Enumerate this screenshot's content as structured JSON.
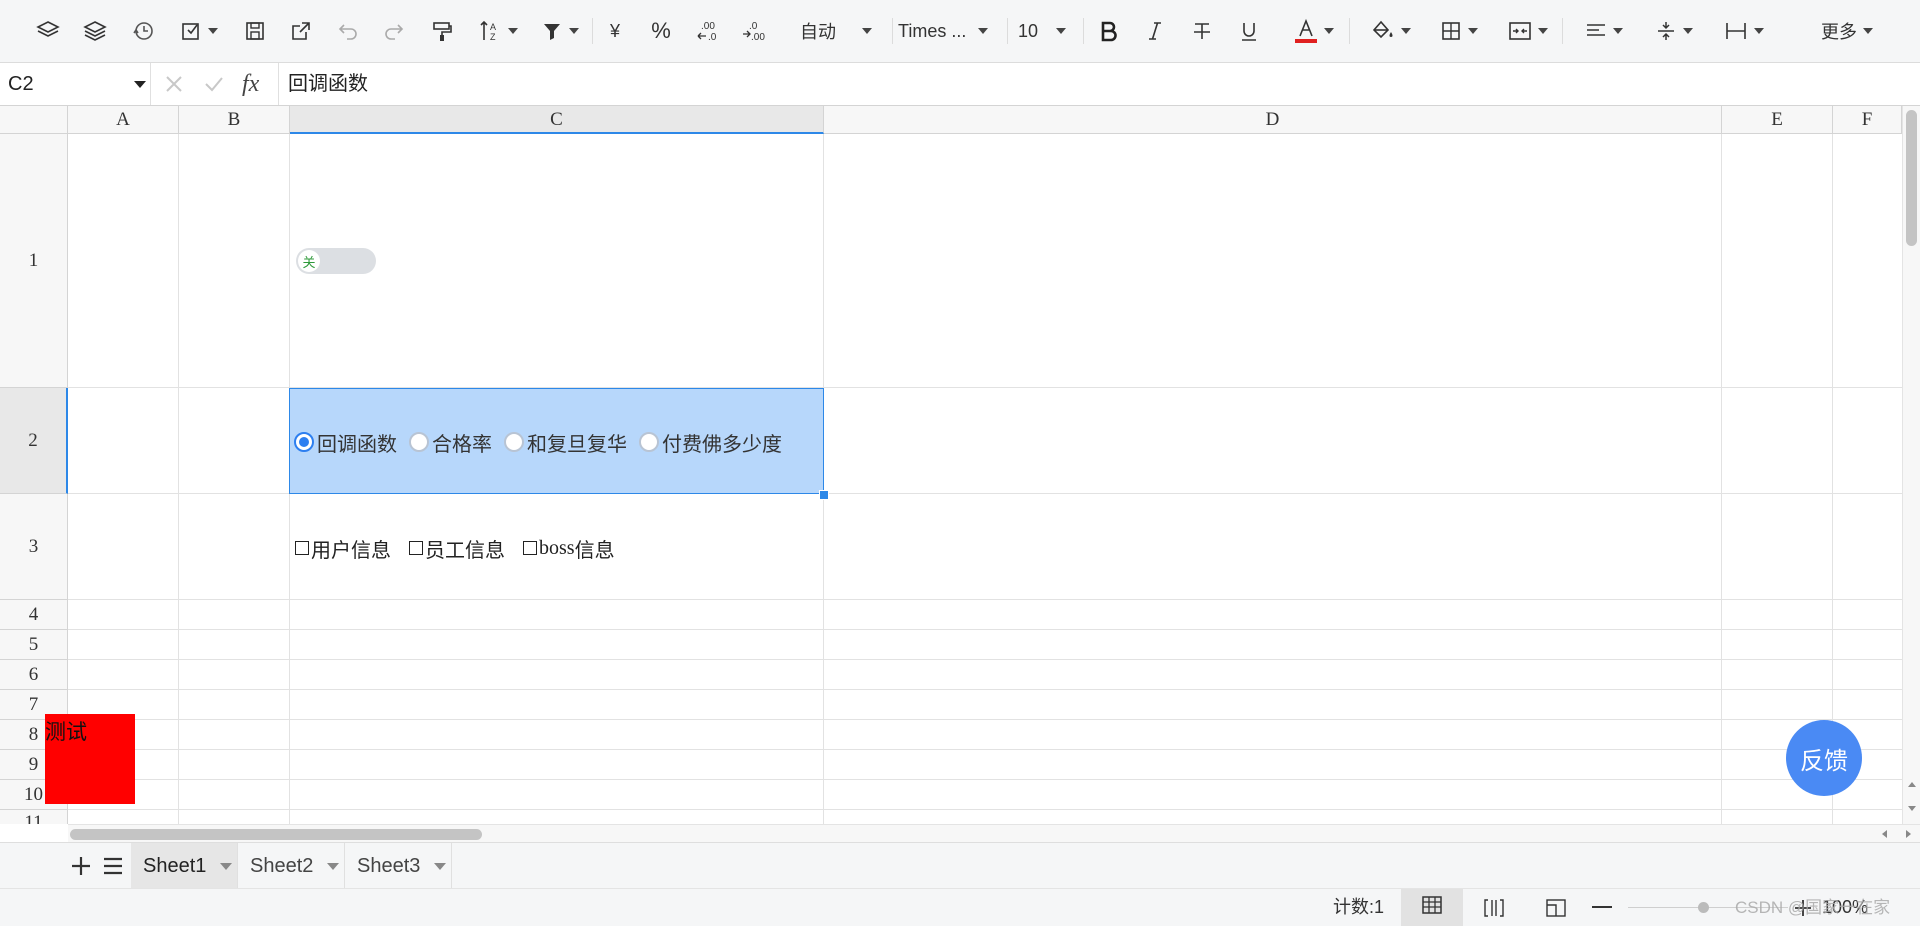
{
  "toolbar": {
    "number_format": "自动",
    "font_name": "Times ...",
    "font_size": "10",
    "currency_symbol": "¥",
    "percent_symbol": "%",
    "more_label": "更多",
    "font_color": "#e02020"
  },
  "formula_bar": {
    "cell_ref": "C2",
    "fx_label": "fx",
    "content": "回调函数"
  },
  "columns": [
    "A",
    "B",
    "C",
    "D",
    "E",
    "F"
  ],
  "rows": [
    "1",
    "2",
    "3",
    "4",
    "5",
    "6",
    "7",
    "8",
    "9",
    "10",
    "11"
  ],
  "selected_cell": "C2",
  "cells": {
    "c1_toggle": {
      "label": "关",
      "on": false
    },
    "c2_radios": {
      "options": [
        "回调函数",
        "合格率",
        "和复旦复华",
        "付费佛多少度"
      ],
      "selected": "回调函数"
    },
    "c3_checkboxes": {
      "options": [
        {
          "label_latin": "",
          "label_cjk": "用户信息",
          "checked": false
        },
        {
          "label_latin": "",
          "label_cjk": "员工信息",
          "checked": false
        },
        {
          "label_latin": "boss",
          "label_cjk": "信息",
          "checked": false
        }
      ]
    }
  },
  "floating_shape": {
    "text": "测试",
    "color": "#ff0000"
  },
  "feedback_button": {
    "label": "反馈",
    "color": "#4a8af4"
  },
  "sheet_tabs": [
    "Sheet1",
    "Sheet2",
    "Sheet3"
  ],
  "active_sheet": "Sheet1",
  "status_bar": {
    "count_label": "计数:1",
    "zoom": "100%",
    "watermark": "CSDN @国家一在家"
  },
  "colors": {
    "selection_fill": "#b7d7fb",
    "selection_border": "#2d88e8",
    "accent": "#2d7ff0"
  }
}
